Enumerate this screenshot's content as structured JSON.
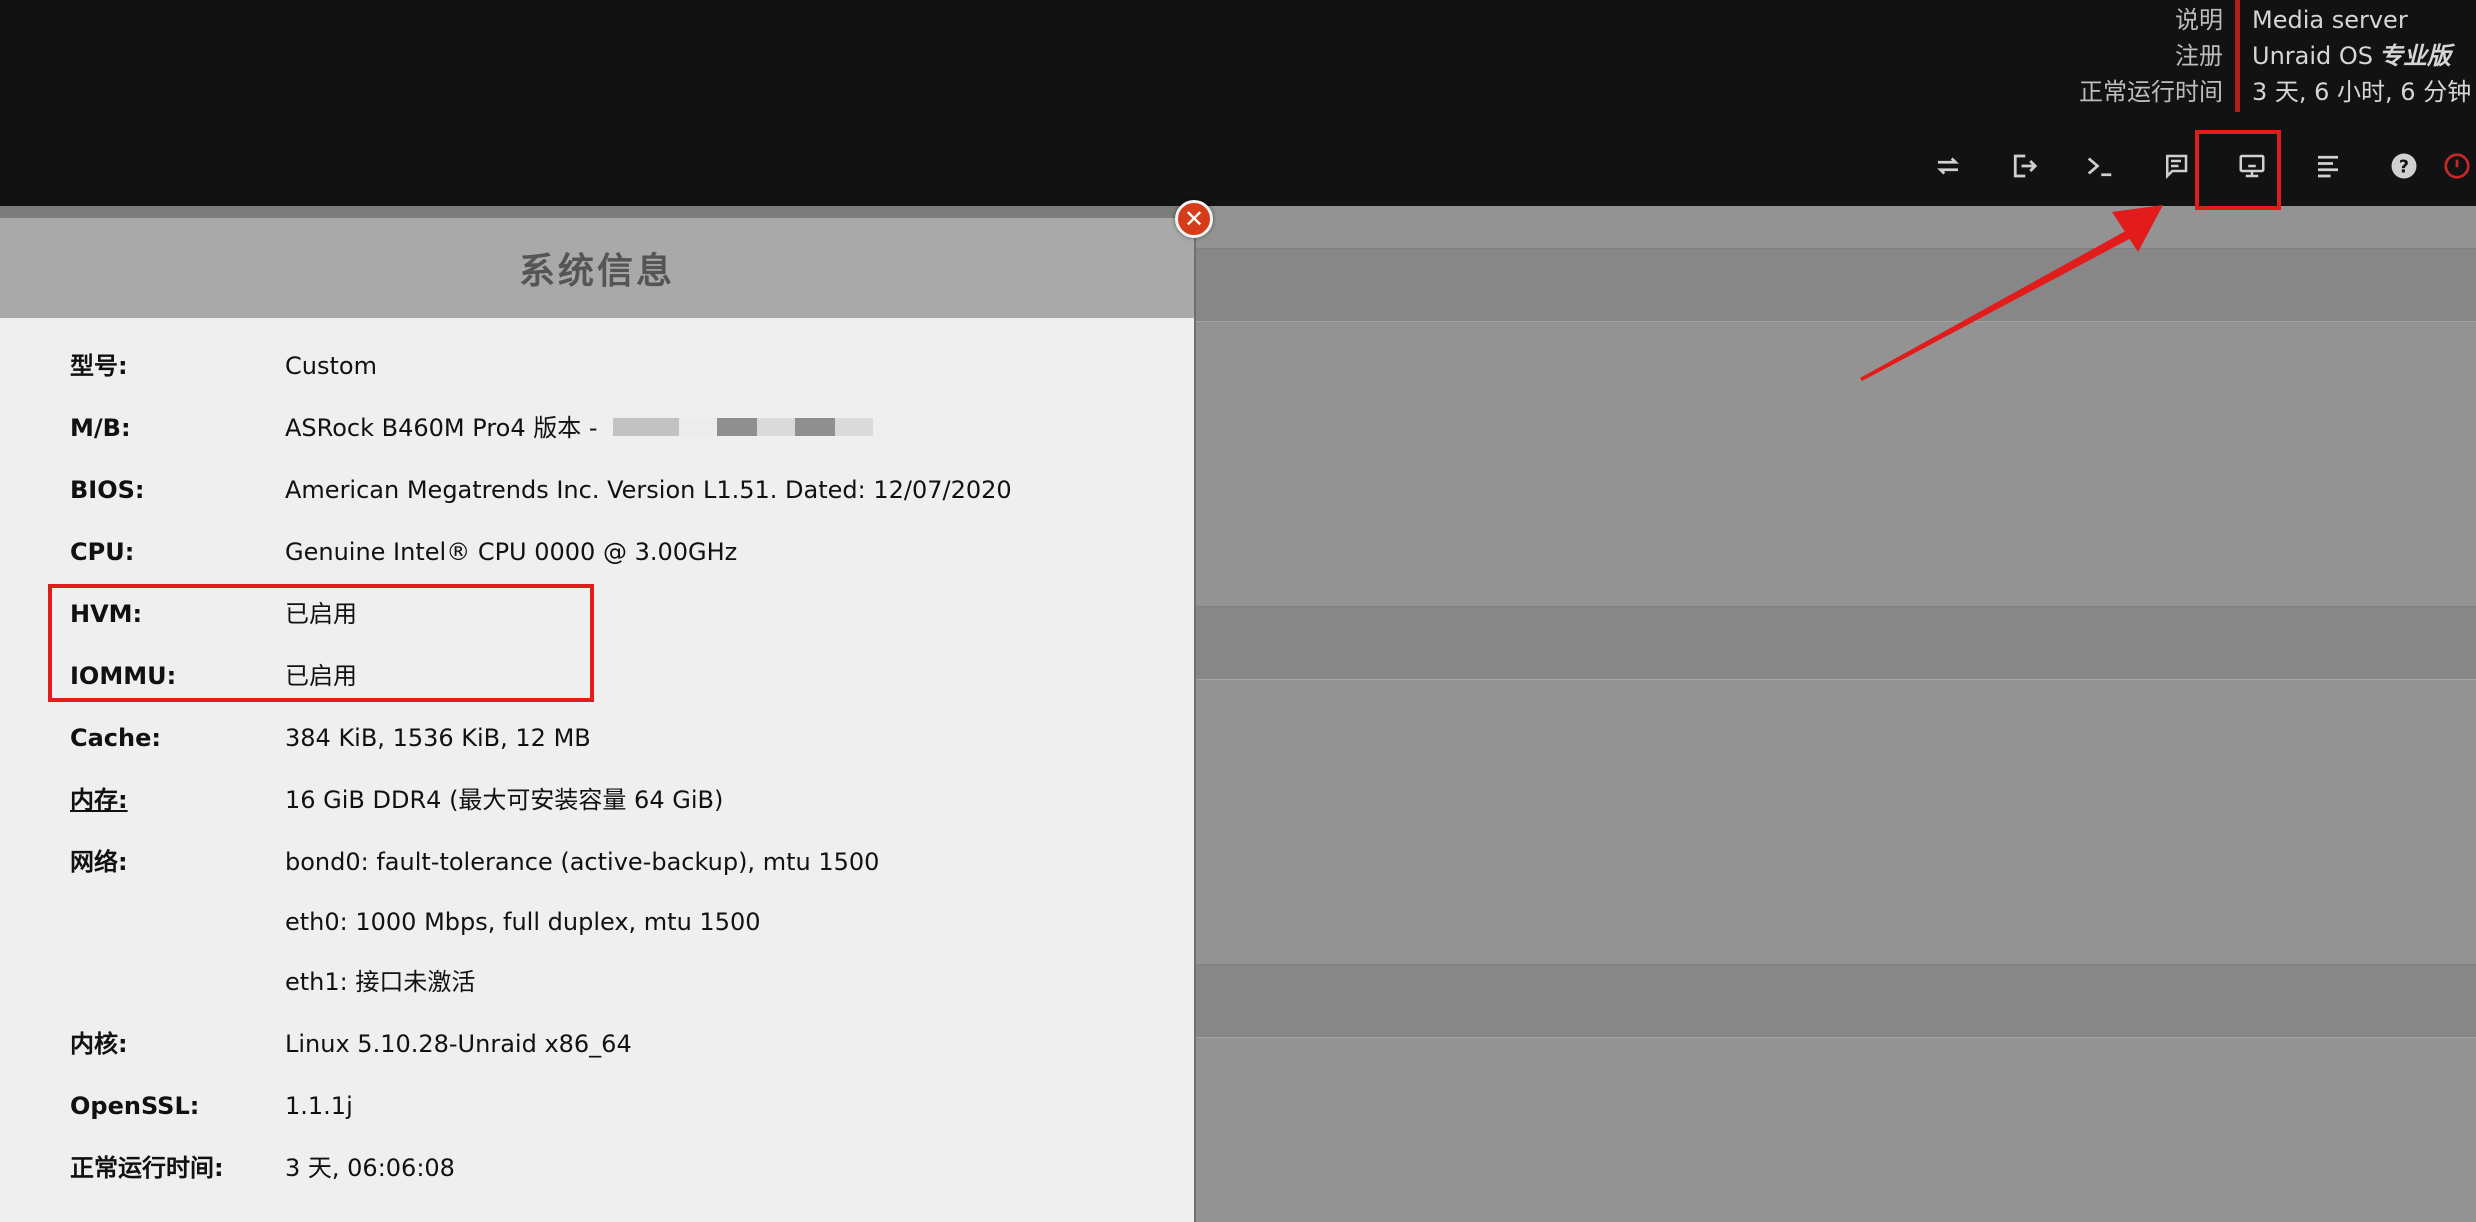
{
  "header": {
    "info_labels": [
      "说明",
      "注册",
      "正常运行时间"
    ],
    "server_name": "Media server",
    "os_name": "Unraid OS",
    "os_edition": "专业版",
    "uptime": "3 天, 6 小时, 6 分钟"
  },
  "toolbar": {
    "icons": [
      "switch-icon",
      "logout-icon",
      "terminal-icon",
      "feedback-icon",
      "system-info-icon",
      "log-icon",
      "help-icon",
      "power-icon"
    ]
  },
  "dialog": {
    "title": "系统信息",
    "rows": [
      {
        "label": "型号:",
        "value": "Custom"
      },
      {
        "label": "M/B:",
        "value": "ASRock B460M Pro4 版本 -"
      },
      {
        "label": "BIOS:",
        "value": "American Megatrends Inc. Version L1.51. Dated: 12/07/2020"
      },
      {
        "label": "CPU:",
        "value": "Genuine Intel® CPU 0000 @ 3.00GHz"
      },
      {
        "label": "HVM:",
        "value": "已启用"
      },
      {
        "label": "IOMMU:",
        "value": "已启用"
      },
      {
        "label": "Cache:",
        "value": "384 KiB, 1536 KiB, 12 MB"
      },
      {
        "label": "内存:",
        "value": "16 GiB DDR4 (最大可安装容量 64 GiB)"
      },
      {
        "label": "网络:",
        "value": "bond0: fault-tolerance (active-backup), mtu 1500"
      },
      {
        "label": "",
        "value": "eth0: 1000 Mbps, full duplex, mtu 1500"
      },
      {
        "label": "",
        "value": "eth1: 接口未激活"
      },
      {
        "label": "内核:",
        "value": "Linux 5.10.28-Unraid x86_64"
      },
      {
        "label": "OpenSSL:",
        "value": "1.1.1j"
      },
      {
        "label": "正常运行时间:",
        "value": "3 天, 06:06:08"
      }
    ]
  },
  "colors": {
    "topbar": "#121212",
    "accent_red": "#e21b1b",
    "divider_red": "#b71c1c",
    "backdrop": "#939393",
    "dialog_bg": "#efefef",
    "dialog_header": "#a9a9a9"
  }
}
